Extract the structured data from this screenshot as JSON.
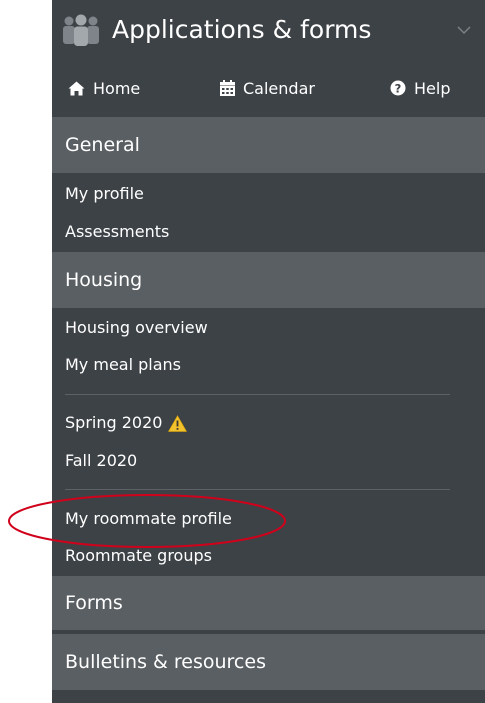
{
  "header": {
    "title": "Applications & forms",
    "icon": "people-icon",
    "toggle_icon": "chevron-down-icon"
  },
  "quick_links": [
    {
      "label": "Home",
      "icon": "home-icon"
    },
    {
      "label": "Calendar",
      "icon": "calendar-icon"
    },
    {
      "label": "Help",
      "icon": "help-icon"
    }
  ],
  "sections": {
    "general": {
      "title": "General",
      "items": [
        "My profile",
        "Assessments"
      ]
    },
    "housing": {
      "title": "Housing",
      "items": [
        "Housing overview",
        "My meal plans",
        "Spring 2020",
        "Fall 2020",
        "My roommate profile",
        "Roommate groups"
      ],
      "warning_icon": "warning-icon"
    },
    "forms": {
      "title": "Forms"
    },
    "bulletins": {
      "title": "Bulletins & resources"
    }
  },
  "colors": {
    "panel_bg": "#3d4247",
    "section_bg": "#5a5f63",
    "text": "#ffffff",
    "annotation": "#d0021b",
    "warning": "#f2c12e"
  }
}
